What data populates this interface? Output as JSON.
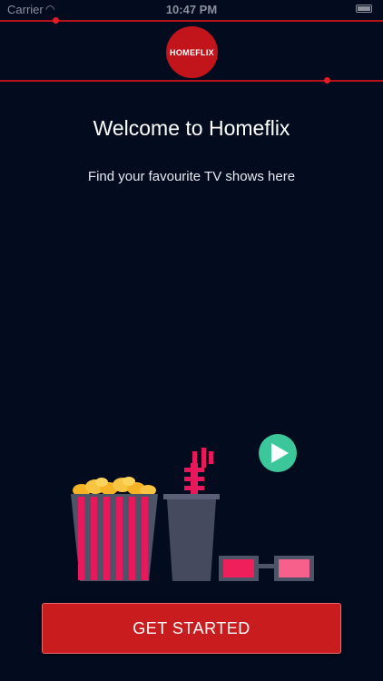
{
  "status_bar": {
    "carrier": "Carrier",
    "time": "10:47 PM"
  },
  "brand": {
    "logo_text": "HOMEFLIX",
    "accent_color": "#c1141b"
  },
  "welcome": {
    "title": "Welcome to Homeflix",
    "subtitle": "Find your favourite TV shows here"
  },
  "cta": {
    "label": "GET STARTED"
  },
  "colors": {
    "background": "#030c1f",
    "button": "#c91c1e",
    "play": "#3cc79a"
  },
  "illustration": {
    "icons": [
      "popcorn-bucket-icon",
      "drink-cup-icon",
      "3d-glasses-icon",
      "play-icon"
    ]
  }
}
